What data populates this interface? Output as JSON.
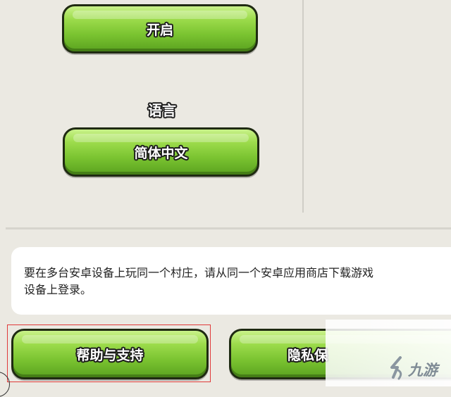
{
  "settings": {
    "toggle_button_label": "开启",
    "language_heading": "语言",
    "language_button_label": "简体中文"
  },
  "info": {
    "text": "要在多台安卓设备上玩同一个村庄，请从同一个安卓应用商店下载游戏\n设备上登录。"
  },
  "footer": {
    "help_button_label": "帮助与支持",
    "privacy_button_label": "隐私保"
  },
  "watermark": {
    "logo_icon": "jiuyou-logo-icon",
    "text": "九游"
  },
  "colors": {
    "button_green": "#7bc431",
    "background": "#ebe9e2",
    "highlight_red": "#e03a3a"
  }
}
